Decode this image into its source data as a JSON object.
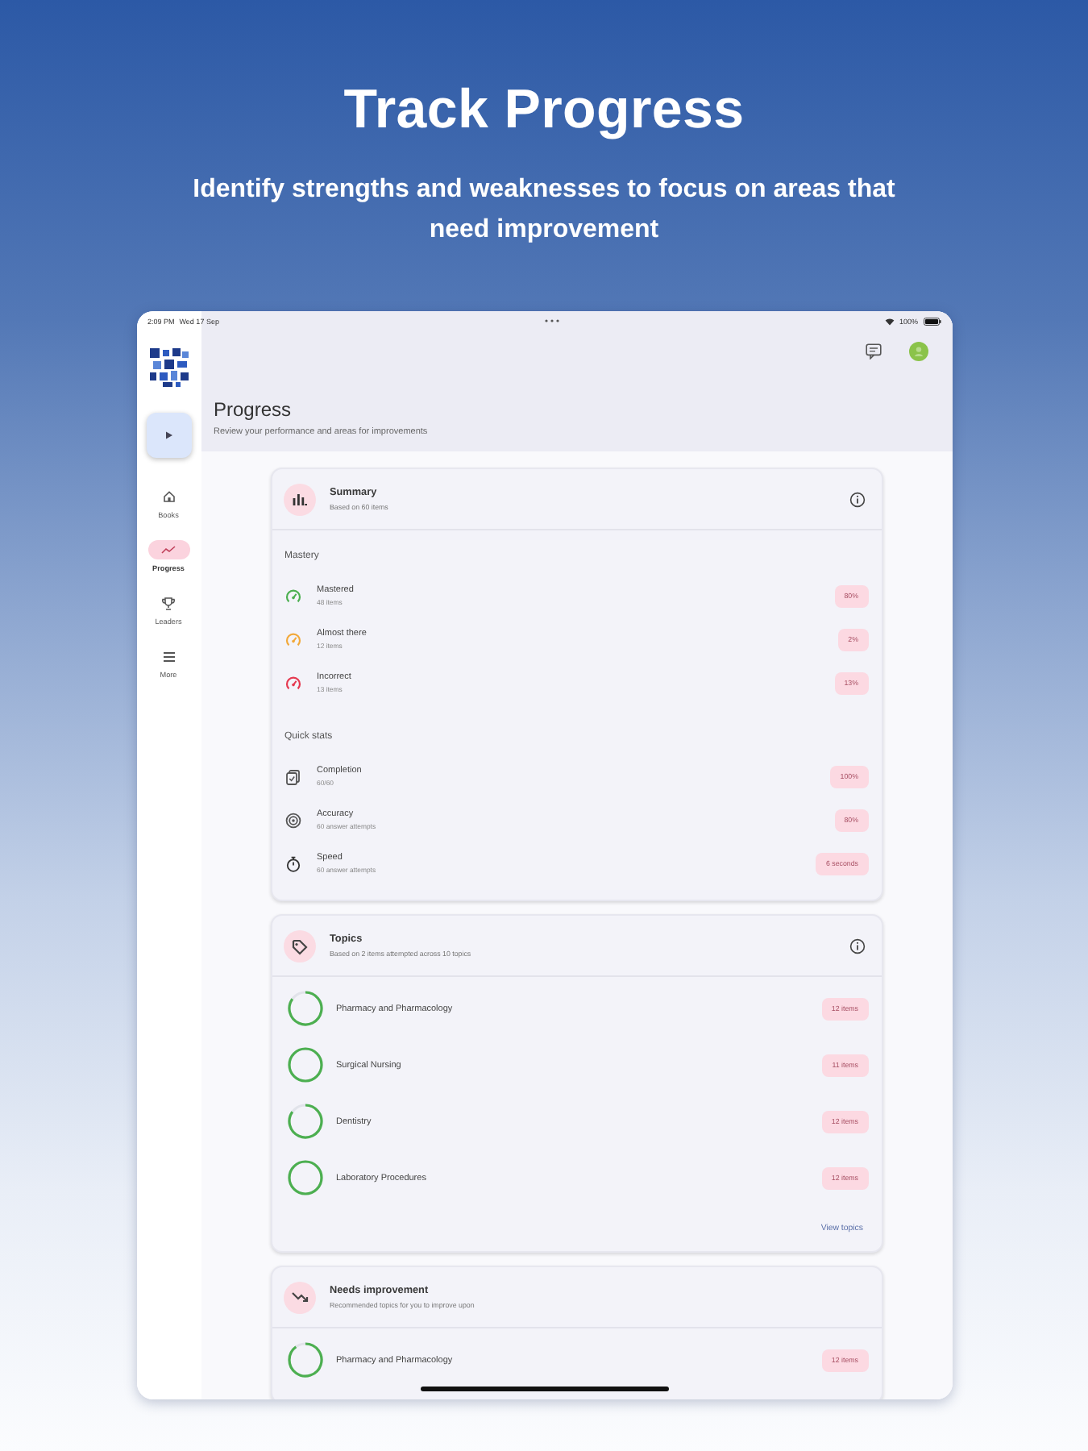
{
  "headline": {
    "title": "Track Progress",
    "subtitle": "Identify strengths and weaknesses to focus on areas that need improvement"
  },
  "status_bar": {
    "time": "2:09 PM",
    "date": "Wed 17 Sep",
    "battery": "100%"
  },
  "sidebar": {
    "items": [
      {
        "kind": "books",
        "label": "Books",
        "selected": false
      },
      {
        "kind": "progress",
        "label": "Progress",
        "selected": true
      },
      {
        "kind": "leaders",
        "label": "Leaders",
        "selected": false
      },
      {
        "kind": "more",
        "label": "More",
        "selected": false
      }
    ]
  },
  "page_header": {
    "title": "Progress",
    "subtitle": "Review your performance and areas for improvements"
  },
  "summary": {
    "title": "Summary",
    "subtitle": "Based on 60 items",
    "sections": [
      {
        "title": "Mastery",
        "rows": [
          {
            "kind": "gauge",
            "label": "Mastered",
            "detail": "48 items",
            "value": "80%",
            "color": "#4caf50"
          },
          {
            "kind": "gauge",
            "label": "Almost there",
            "detail": "12 items",
            "value": "2%",
            "color": "#f2a93b"
          },
          {
            "kind": "gauge",
            "label": "Incorrect",
            "detail": "13 items",
            "value": "13%",
            "color": "#e53950"
          }
        ]
      },
      {
        "title": "Quick stats",
        "rows": [
          {
            "kind": "completion",
            "label": "Completion",
            "detail": "60/60",
            "value": "100%"
          },
          {
            "kind": "accuracy",
            "label": "Accuracy",
            "detail": "60 answer attempts",
            "value": "80%"
          },
          {
            "kind": "speed",
            "label": "Speed",
            "detail": "60 answer attempts",
            "value": "6 seconds"
          }
        ]
      }
    ]
  },
  "topics": {
    "title": "Topics",
    "subtitle": "Based on 2 items attempted across 10 topics",
    "items": [
      {
        "name": "Pharmacy and Pharmacology",
        "count": "12 items",
        "level": 0.85
      },
      {
        "name": "Surgical Nursing",
        "count": "11 items",
        "level": 1
      },
      {
        "name": "Dentistry",
        "count": "12 items",
        "level": 0.85
      },
      {
        "name": "Laboratory Procedures",
        "count": "12 items",
        "level": 1
      }
    ],
    "link": "View topics"
  },
  "needs_improvement": {
    "title": "Needs improvement",
    "subtitle": "Recommended topics for you to improve upon",
    "items": [
      {
        "name": "Pharmacy and Pharmacology",
        "count": "12 items",
        "level": 0.9
      }
    ]
  }
}
